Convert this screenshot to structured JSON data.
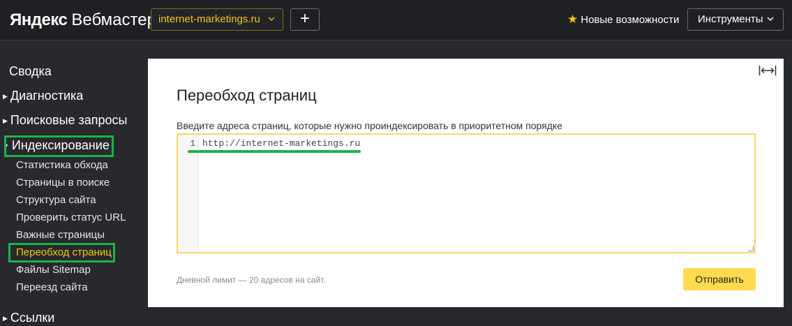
{
  "header": {
    "logo_brand": "Яндекс",
    "logo_product": "Вебмастер",
    "site_select_value": "internet-marketings.ru",
    "add_button": "+",
    "whats_new": "Новые возможности",
    "tools_button": "Инструменты"
  },
  "sidebar": {
    "summary": "Сводка",
    "diagnostics": "Диагностика",
    "search_queries": "Поисковые запросы",
    "indexing": "Индексирование",
    "indexing_items": [
      {
        "label": "Статистика обхода"
      },
      {
        "label": "Страницы в поиске"
      },
      {
        "label": "Структура сайта"
      },
      {
        "label": "Проверить статус URL"
      },
      {
        "label": "Важные страницы"
      },
      {
        "label": "Переобход страниц",
        "active": true
      },
      {
        "label": "Файлы Sitemap"
      },
      {
        "label": "Переезд сайта"
      }
    ],
    "links": "Ссылки"
  },
  "main": {
    "title": "Переобход страниц",
    "field_label": "Введите адреса страниц, которые нужно проиндексировать в приоритетном порядке",
    "editor": {
      "line_number": "1",
      "line_text": "http://internet-marketings.ru"
    },
    "limit_text": "Дневной лимит — 20 адресов на сайт.",
    "submit_button": "Отправить"
  },
  "colors": {
    "accent_yellow": "#f7c600",
    "highlight_green": "#1bb34a",
    "button_yellow": "#ffdb4d",
    "sidebar_bg": "#27292d"
  },
  "icons": [
    "star-icon",
    "chevron-down-icon",
    "plus-icon",
    "expand-width-icon",
    "triangle-right-icon",
    "triangle-down-icon"
  ]
}
